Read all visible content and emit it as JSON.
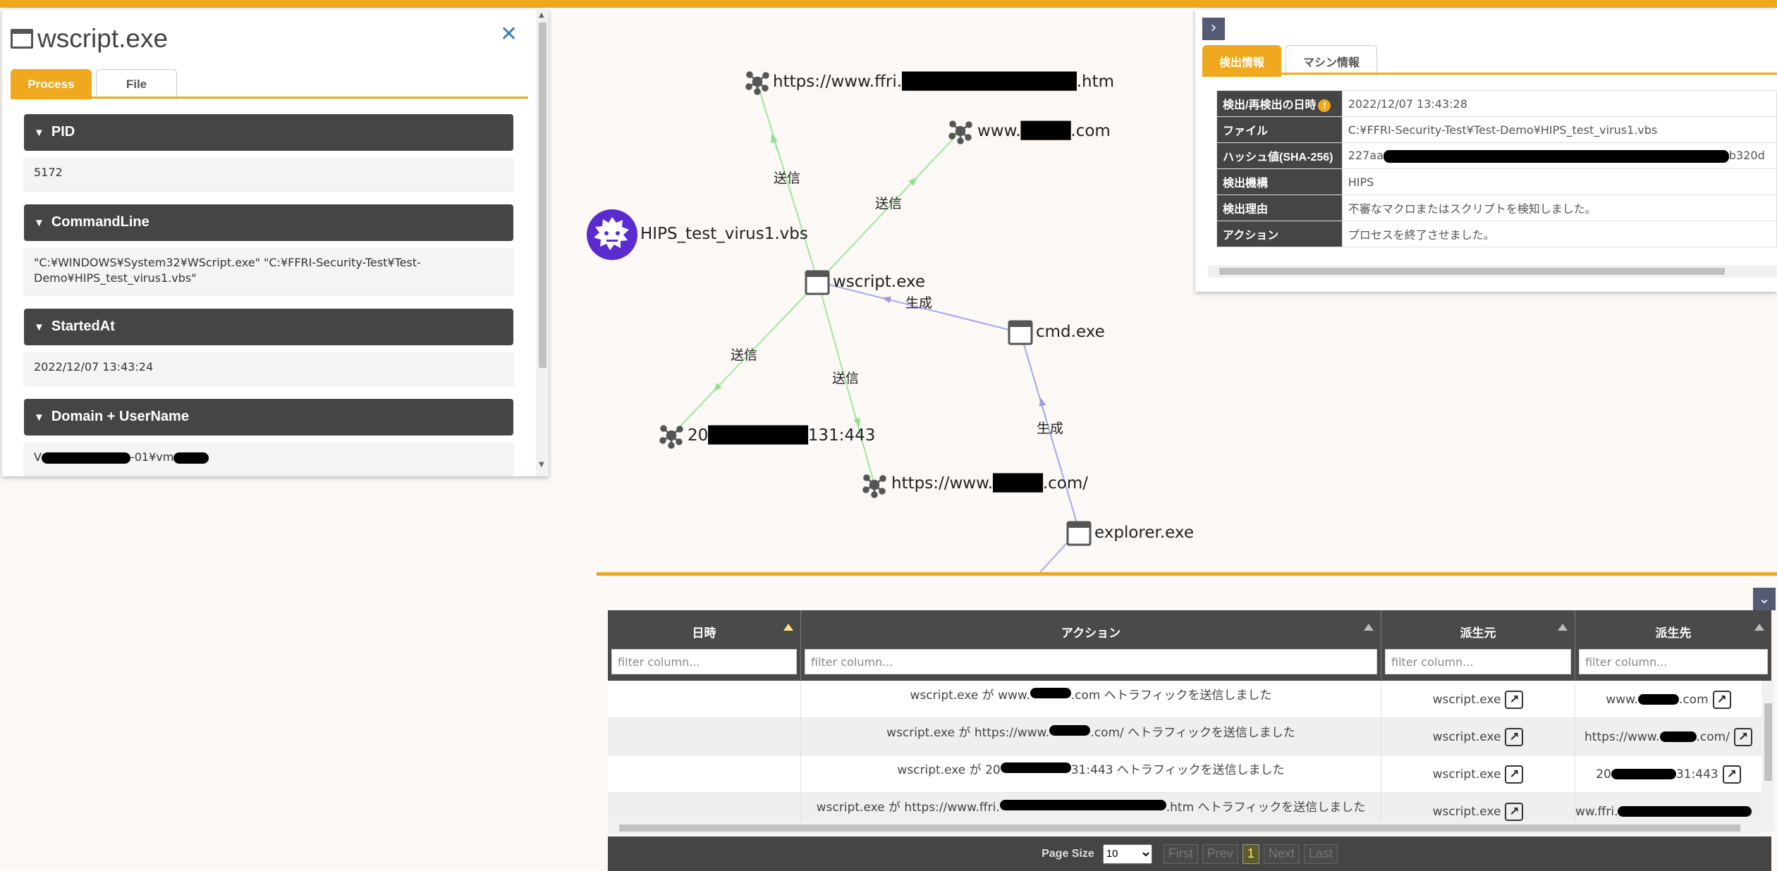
{
  "process_panel": {
    "title": "wscript.exe",
    "tabs": [
      "Process",
      "File"
    ],
    "sections": [
      {
        "label": "PID",
        "value": "5172"
      },
      {
        "label": "CommandLine",
        "value": "\"C:¥WINDOWS¥System32¥WScript.exe\" \"C:¥FFRI-Security-Test¥Test-Demo¥HIPS_test_virus1.vbs\""
      },
      {
        "label": "StartedAt",
        "value": "2022/12/07 13:43:24"
      },
      {
        "label": "Domain + UserName",
        "value_prefix": "V",
        "value_mid": "-01¥vm"
      }
    ]
  },
  "graph": {
    "nodes": {
      "url_ffri": {
        "prefix": "https://www.ffri.",
        "suffix": ".htm"
      },
      "url_www_com": {
        "prefix": "www.",
        "suffix": ".com"
      },
      "virus": {
        "label": "HIPS_test_virus1.vbs"
      },
      "wscript": {
        "label": "wscript.exe"
      },
      "cmd": {
        "label": "cmd.exe"
      },
      "ip": {
        "prefix": "20",
        "suffix": "131:443"
      },
      "url_www_slash": {
        "prefix": "https://www.",
        "suffix": ".com/"
      },
      "explorer": {
        "label": "explorer.exe"
      }
    },
    "edges": {
      "send": "送信",
      "spawn": "生成"
    },
    "colors": {
      "send_edge": "#9ee89a",
      "spawn_edge": "#a6a6ee",
      "virus_node": "#5b2bd1"
    }
  },
  "detection_panel": {
    "tabs": [
      "検出情報",
      "マシン情報"
    ],
    "rows": [
      {
        "key": "検出/再検出の日時",
        "value": "2022/12/07 13:43:28",
        "warn": "!"
      },
      {
        "key": "ファイル",
        "value": "C:¥FFRI-Security-Test¥Test-Demo¥HIPS_test_virus1.vbs"
      },
      {
        "key": "ハッシュ値(SHA-256)",
        "value_prefix": "227aa",
        "value_suffix": "b320d"
      },
      {
        "key": "検出機構",
        "value": "HIPS"
      },
      {
        "key": "検出理由",
        "value": "不審なマクロまたはスクリプトを検知しました。"
      },
      {
        "key": "アクション",
        "value": "プロセスを終了させました。"
      }
    ]
  },
  "event_grid": {
    "columns": [
      "日時",
      "アクション",
      "派生元",
      "派生先"
    ],
    "filter_placeholder": "filter column...",
    "rows": [
      {
        "action_pre": "wscript.exe が www.",
        "action_post": ".com へトラフィックを送信しました",
        "source": "wscript.exe",
        "target_pre": "www.",
        "target_post": ".com"
      },
      {
        "action_pre": "wscript.exe が https://www.",
        "action_post": ".com/ へトラフィックを送信しました",
        "source": "wscript.exe",
        "target_pre": "https://www.",
        "target_post": ".com/"
      },
      {
        "action_pre": "wscript.exe が 20",
        "action_post": "31:443 へトラフィックを送信しました",
        "source": "wscript.exe",
        "target_pre": "20",
        "target_post": "31:443"
      },
      {
        "action_pre": "wscript.exe が https://www.ffri.",
        "action_post": ".htm へトラフィックを送信しました",
        "source": "wscript.exe",
        "target_pre": "ww.ffri.",
        "target_post": ""
      }
    ],
    "pager": {
      "page_size_label": "Page Size",
      "page_size": "10",
      "first": "First",
      "prev": "Prev",
      "current": "1",
      "next": "Next",
      "last": "Last"
    }
  }
}
